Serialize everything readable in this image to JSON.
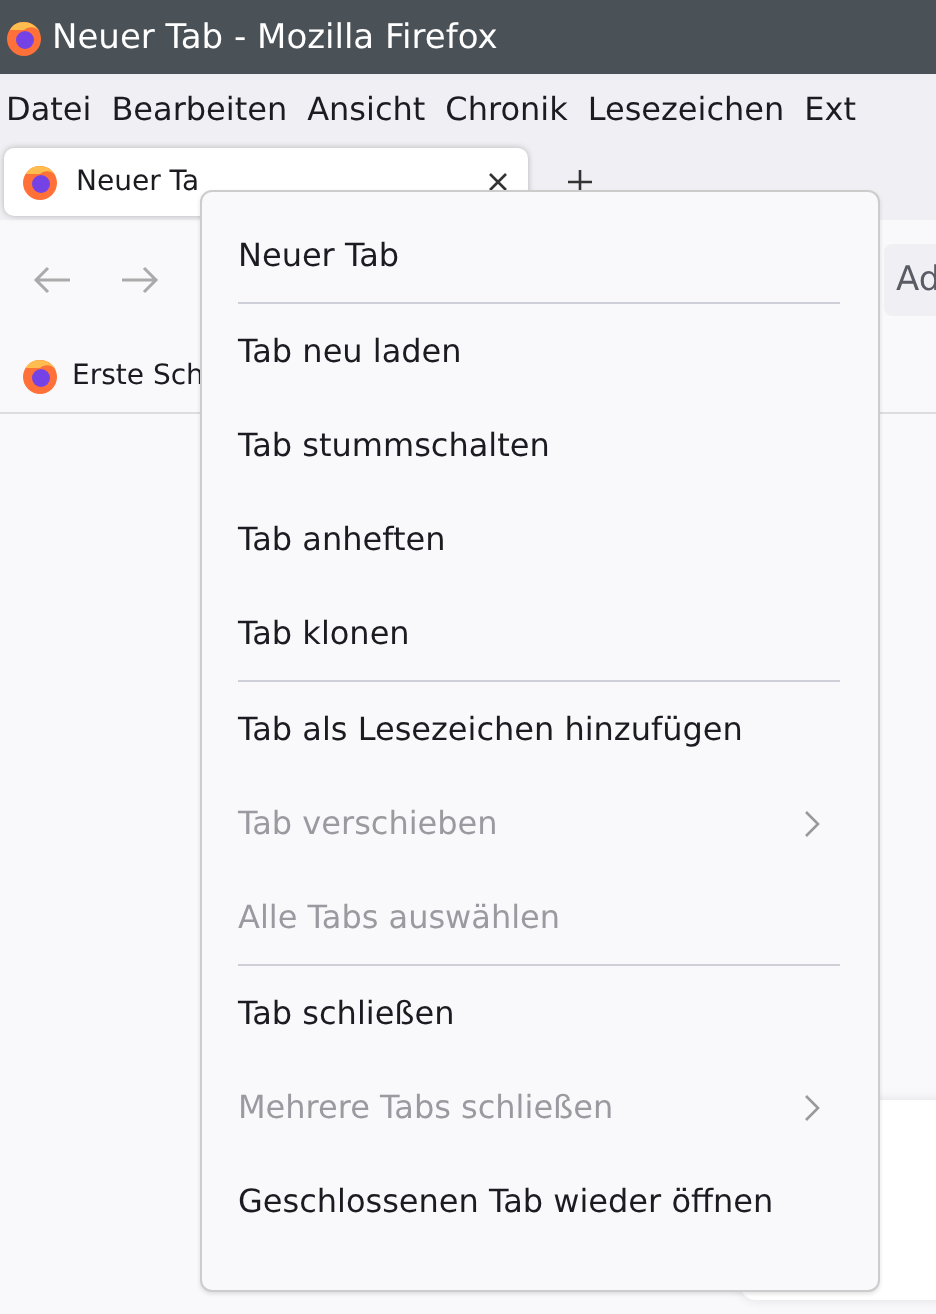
{
  "window": {
    "title": "Neuer Tab - Mozilla Firefox"
  },
  "menubar": [
    {
      "label": "Datei"
    },
    {
      "label": "Bearbeiten"
    },
    {
      "label": "Ansicht"
    },
    {
      "label": "Chronik"
    },
    {
      "label": "Lesezeichen"
    },
    {
      "label": "Ext"
    }
  ],
  "tabs": [
    {
      "label": "Neuer Ta",
      "selected": true
    }
  ],
  "address_bar": {
    "text": "Ad"
  },
  "bookmarks": [
    {
      "label": "Erste Sch"
    }
  ],
  "context_menu": [
    {
      "kind": "item",
      "label": "Neuer Tab",
      "disabled": false,
      "submenu": false
    },
    {
      "kind": "separator"
    },
    {
      "kind": "item",
      "label": "Tab neu laden",
      "disabled": false,
      "submenu": false
    },
    {
      "kind": "item",
      "label": "Tab stummschalten",
      "disabled": false,
      "submenu": false
    },
    {
      "kind": "item",
      "label": "Tab anheften",
      "disabled": false,
      "submenu": false
    },
    {
      "kind": "item",
      "label": "Tab klonen",
      "disabled": false,
      "submenu": false
    },
    {
      "kind": "separator"
    },
    {
      "kind": "item",
      "label": "Tab als Lesezeichen hinzufügen",
      "disabled": false,
      "submenu": false
    },
    {
      "kind": "item",
      "label": "Tab verschieben",
      "disabled": true,
      "submenu": true
    },
    {
      "kind": "item",
      "label": "Alle Tabs auswählen",
      "disabled": true,
      "submenu": false
    },
    {
      "kind": "separator"
    },
    {
      "kind": "item",
      "label": "Tab schließen",
      "disabled": false,
      "submenu": false
    },
    {
      "kind": "item",
      "label": "Mehrere Tabs schließen",
      "disabled": true,
      "submenu": true
    },
    {
      "kind": "item",
      "label": "Geschlossenen Tab wieder öffnen",
      "disabled": false,
      "submenu": false
    }
  ]
}
